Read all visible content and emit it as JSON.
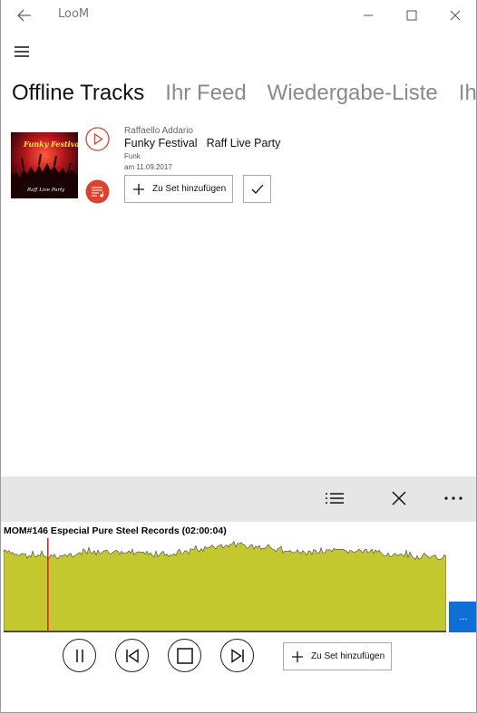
{
  "app": {
    "title": "LooM"
  },
  "icons": {
    "back": "back-arrow-icon",
    "minimize": "minimize-icon",
    "maximize": "maximize-icon",
    "close": "close-icon",
    "menu": "hamburger-menu-icon",
    "play": "play-circle-icon",
    "playlist": "playlist-icon",
    "plus": "plus-icon",
    "check": "checkmark-icon",
    "list": "list-icon",
    "more": "more-icon",
    "pause": "pause-icon",
    "previous": "previous-track-icon",
    "stop": "stop-icon",
    "next": "next-track-icon"
  },
  "colors": {
    "accent": "#d9432f",
    "waveform": "#c3c82e",
    "playhead": "#d62b1e",
    "side_button": "#0f6fd6",
    "toolbar_bg": "#e6e6e6"
  },
  "pivot": {
    "tabs": [
      {
        "label": "Offline Tracks",
        "active": true
      },
      {
        "label": "Ihr Feed",
        "active": false
      },
      {
        "label": "Wiedergabe-Liste",
        "active": false
      },
      {
        "label": "Ih",
        "active": false
      }
    ]
  },
  "track": {
    "artist": "Raffaello Addario",
    "title": "Funky Festival",
    "album": "Raff Live Party",
    "genre": "Funk",
    "date": "am 11.09.2017",
    "cover_text_top": "Funky Festival",
    "cover_text_bottom": "Raff Live Party",
    "add_to_set_label": "Zu Set hinzufügen"
  },
  "player": {
    "now_playing": "MOM#146 Especial Pure Steel Records (02:00:04)",
    "progress": 0.1,
    "side_button_label": "...",
    "add_to_set_label": "Zu Set hinzufügen"
  }
}
